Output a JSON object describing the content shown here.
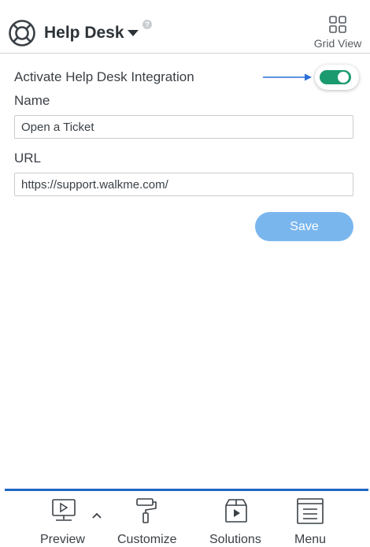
{
  "header": {
    "title": "Help Desk",
    "title_icon": "lifebuoy-icon",
    "help_icon_glyph": "?",
    "grid_view_label": "Grid View"
  },
  "form": {
    "activate_label": "Activate Help Desk Integration",
    "activate_enabled": true,
    "toggle_color": "#1b9a6f",
    "name_label": "Name",
    "name_value": "Open a Ticket",
    "url_label": "URL",
    "url_value": "https://support.walkme.com/",
    "save_label": "Save",
    "save_color": "#7ab6ee"
  },
  "footer": {
    "accent_color": "#2166c4",
    "items": [
      {
        "label": "Preview",
        "icon": "monitor-play-icon"
      },
      {
        "label": "Customize",
        "icon": "paint-roller-icon"
      },
      {
        "label": "Solutions",
        "icon": "box-play-icon"
      },
      {
        "label": "Menu",
        "icon": "menu-list-icon"
      }
    ]
  }
}
